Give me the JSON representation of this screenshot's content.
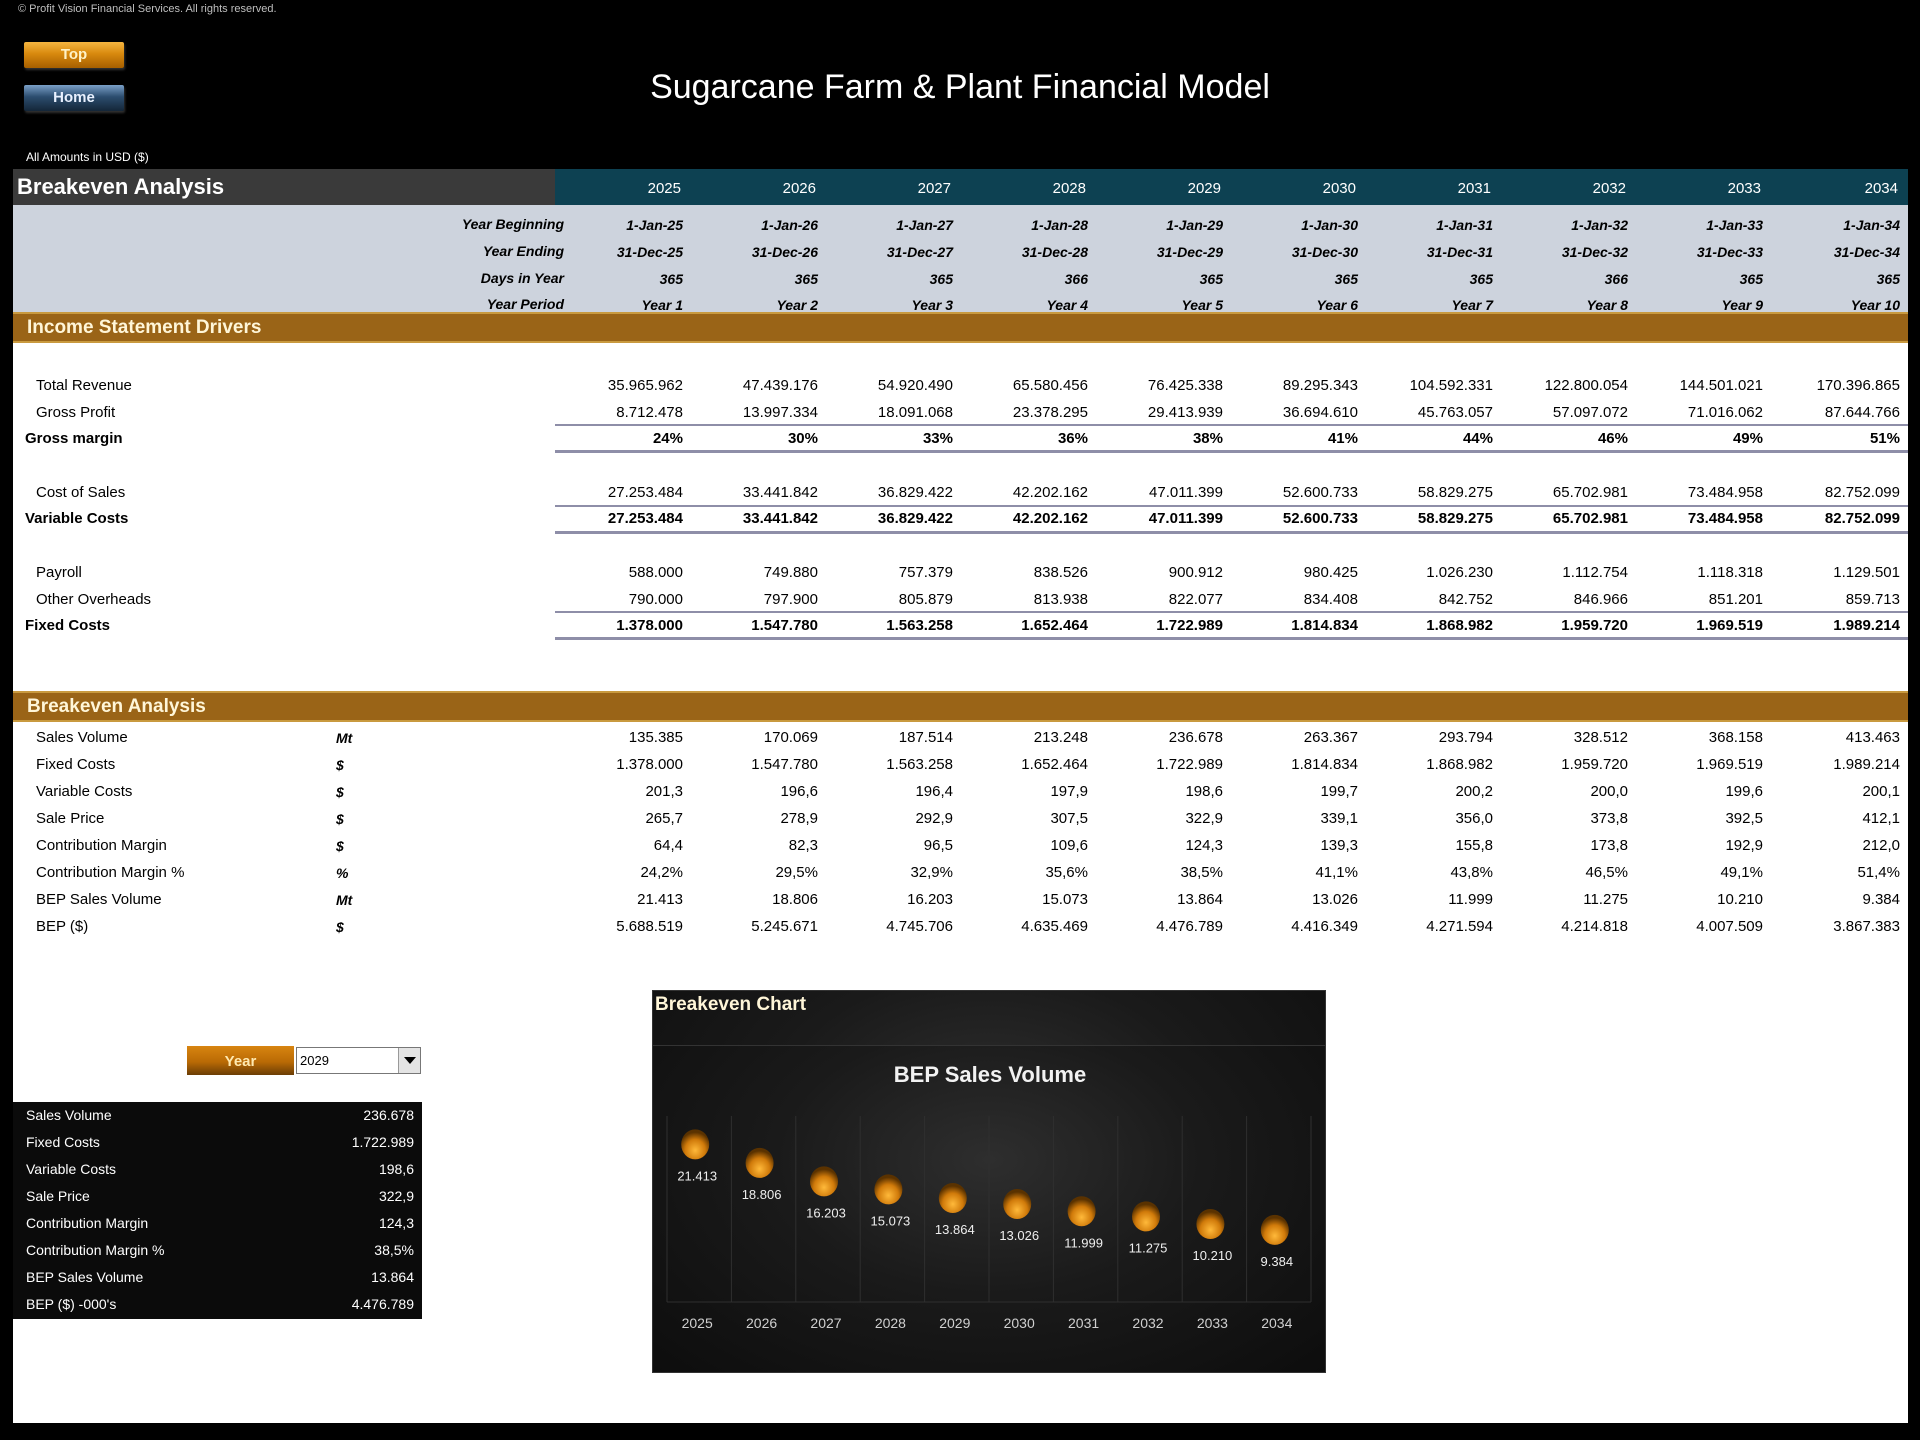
{
  "copyright": "© Profit Vision Financial Services. All rights reserved.",
  "nav": {
    "top_label": "Top",
    "home_label": "Home"
  },
  "title": "Sugarcane Farm & Plant Financial Model",
  "amounts_note": "All Amounts in  USD ($)",
  "header": {
    "section_title": "Breakeven Analysis",
    "years": [
      "2025",
      "2026",
      "2027",
      "2028",
      "2029",
      "2030",
      "2031",
      "2032",
      "2033",
      "2034"
    ]
  },
  "meta": [
    {
      "label": "Year Beginning",
      "values": [
        "1-Jan-25",
        "1-Jan-26",
        "1-Jan-27",
        "1-Jan-28",
        "1-Jan-29",
        "1-Jan-30",
        "1-Jan-31",
        "1-Jan-32",
        "1-Jan-33",
        "1-Jan-34"
      ]
    },
    {
      "label": "Year Ending",
      "values": [
        "31-Dec-25",
        "31-Dec-26",
        "31-Dec-27",
        "31-Dec-28",
        "31-Dec-29",
        "31-Dec-30",
        "31-Dec-31",
        "31-Dec-32",
        "31-Dec-33",
        "31-Dec-34"
      ]
    },
    {
      "label": "Days in Year",
      "values": [
        "365",
        "365",
        "365",
        "366",
        "365",
        "365",
        "365",
        "366",
        "365",
        "365"
      ]
    },
    {
      "label": "Year Period",
      "values": [
        "Year 1",
        "Year 2",
        "Year 3",
        "Year 4",
        "Year 5",
        "Year 6",
        "Year 7",
        "Year 8",
        "Year 9",
        "Year 10"
      ]
    }
  ],
  "income_drivers": {
    "title": "Income Statement Drivers",
    "rows": [
      {
        "label": "Total Revenue",
        "values": [
          "35.965.962",
          "47.439.176",
          "54.920.490",
          "65.580.456",
          "76.425.338",
          "89.295.343",
          "104.592.331",
          "122.800.054",
          "144.501.021",
          "170.396.865"
        ]
      },
      {
        "label": "Gross Profit",
        "values": [
          "8.712.478",
          "13.997.334",
          "18.091.068",
          "23.378.295",
          "29.413.939",
          "36.694.610",
          "45.763.057",
          "57.097.072",
          "71.016.062",
          "87.644.766"
        ]
      },
      {
        "label": "Gross margin",
        "values": [
          "24%",
          "30%",
          "33%",
          "36%",
          "38%",
          "41%",
          "44%",
          "46%",
          "49%",
          "51%"
        ]
      },
      {
        "label": "Cost of Sales",
        "values": [
          "27.253.484",
          "33.441.842",
          "36.829.422",
          "42.202.162",
          "47.011.399",
          "52.600.733",
          "58.829.275",
          "65.702.981",
          "73.484.958",
          "82.752.099"
        ]
      },
      {
        "label": "Variable Costs",
        "values": [
          "27.253.484",
          "33.441.842",
          "36.829.422",
          "42.202.162",
          "47.011.399",
          "52.600.733",
          "58.829.275",
          "65.702.981",
          "73.484.958",
          "82.752.099"
        ]
      },
      {
        "label": "Payroll",
        "values": [
          "588.000",
          "749.880",
          "757.379",
          "838.526",
          "900.912",
          "980.425",
          "1.026.230",
          "1.112.754",
          "1.118.318",
          "1.129.501"
        ]
      },
      {
        "label": "Other Overheads",
        "values": [
          "790.000",
          "797.900",
          "805.879",
          "813.938",
          "822.077",
          "834.408",
          "842.752",
          "846.966",
          "851.201",
          "859.713"
        ]
      },
      {
        "label": "Fixed Costs",
        "values": [
          "1.378.000",
          "1.547.780",
          "1.563.258",
          "1.652.464",
          "1.722.989",
          "1.814.834",
          "1.868.982",
          "1.959.720",
          "1.969.519",
          "1.989.214"
        ]
      }
    ]
  },
  "breakeven": {
    "title": "Breakeven Analysis",
    "rows": [
      {
        "label": "Sales Volume",
        "unit": "Mt",
        "values": [
          "135.385",
          "170.069",
          "187.514",
          "213.248",
          "236.678",
          "263.367",
          "293.794",
          "328.512",
          "368.158",
          "413.463"
        ]
      },
      {
        "label": "Fixed Costs",
        "unit": "$",
        "values": [
          "1.378.000",
          "1.547.780",
          "1.563.258",
          "1.652.464",
          "1.722.989",
          "1.814.834",
          "1.868.982",
          "1.959.720",
          "1.969.519",
          "1.989.214"
        ]
      },
      {
        "label": "Variable Costs",
        "unit": "$",
        "values": [
          "201,3",
          "196,6",
          "196,4",
          "197,9",
          "198,6",
          "199,7",
          "200,2",
          "200,0",
          "199,6",
          "200,1"
        ]
      },
      {
        "label": "Sale Price",
        "unit": "$",
        "values": [
          "265,7",
          "278,9",
          "292,9",
          "307,5",
          "322,9",
          "339,1",
          "356,0",
          "373,8",
          "392,5",
          "412,1"
        ]
      },
      {
        "label": "Contribution Margin",
        "unit": "$",
        "values": [
          "64,4",
          "82,3",
          "96,5",
          "109,6",
          "124,3",
          "139,3",
          "155,8",
          "173,8",
          "192,9",
          "212,0"
        ]
      },
      {
        "label": "Contribution Margin %",
        "unit": "%",
        "values": [
          "24,2%",
          "29,5%",
          "32,9%",
          "35,6%",
          "38,5%",
          "41,1%",
          "43,8%",
          "46,5%",
          "49,1%",
          "51,4%"
        ]
      },
      {
        "label": "BEP Sales Volume",
        "unit": "Mt",
        "values": [
          "21.413",
          "18.806",
          "16.203",
          "15.073",
          "13.864",
          "13.026",
          "11.999",
          "11.275",
          "10.210",
          "9.384"
        ]
      },
      {
        "label": "BEP ($)",
        "unit": "$",
        "values": [
          "5.688.519",
          "5.245.671",
          "4.745.706",
          "4.635.469",
          "4.476.789",
          "4.416.349",
          "4.271.594",
          "4.214.818",
          "4.007.509",
          "3.867.383"
        ]
      }
    ]
  },
  "breakeven_chart_section": {
    "title": "Breakeven Chart",
    "year_button_label": "Year",
    "selected_year": "2029",
    "summary": [
      {
        "label": "Sales Volume",
        "value": "236.678"
      },
      {
        "label": "Fixed Costs",
        "value": "1.722.989"
      },
      {
        "label": "Variable Costs",
        "value": "198,6"
      },
      {
        "label": "Sale Price",
        "value": "322,9"
      },
      {
        "label": "Contribution Margin",
        "value": "124,3"
      },
      {
        "label": "Contribution Margin %",
        "value": "38,5%"
      },
      {
        "label": "BEP Sales Volume",
        "value": "13.864"
      },
      {
        "label": "BEP ($) -000's",
        "value": "4.476.789"
      }
    ]
  },
  "colors": {
    "accent_band": "#9a6417",
    "year_header": "#0d4152",
    "marker": "#e89a1c"
  },
  "chart_data": {
    "type": "scatter",
    "title": "BEP Sales Volume",
    "xlabel": "",
    "ylabel": "",
    "categories": [
      "2025",
      "2026",
      "2027",
      "2028",
      "2029",
      "2030",
      "2031",
      "2032",
      "2033",
      "2034"
    ],
    "values": [
      21413,
      18806,
      16203,
      15073,
      13864,
      13026,
      11999,
      11275,
      10210,
      9384
    ],
    "data_labels": [
      "21.413",
      "18.806",
      "16.203",
      "15.073",
      "13.864",
      "13.026",
      "11.999",
      "11.275",
      "10.210",
      "9.384"
    ],
    "ylim": [
      0,
      25000
    ],
    "grid": "vertical category separators",
    "legend": "none"
  }
}
